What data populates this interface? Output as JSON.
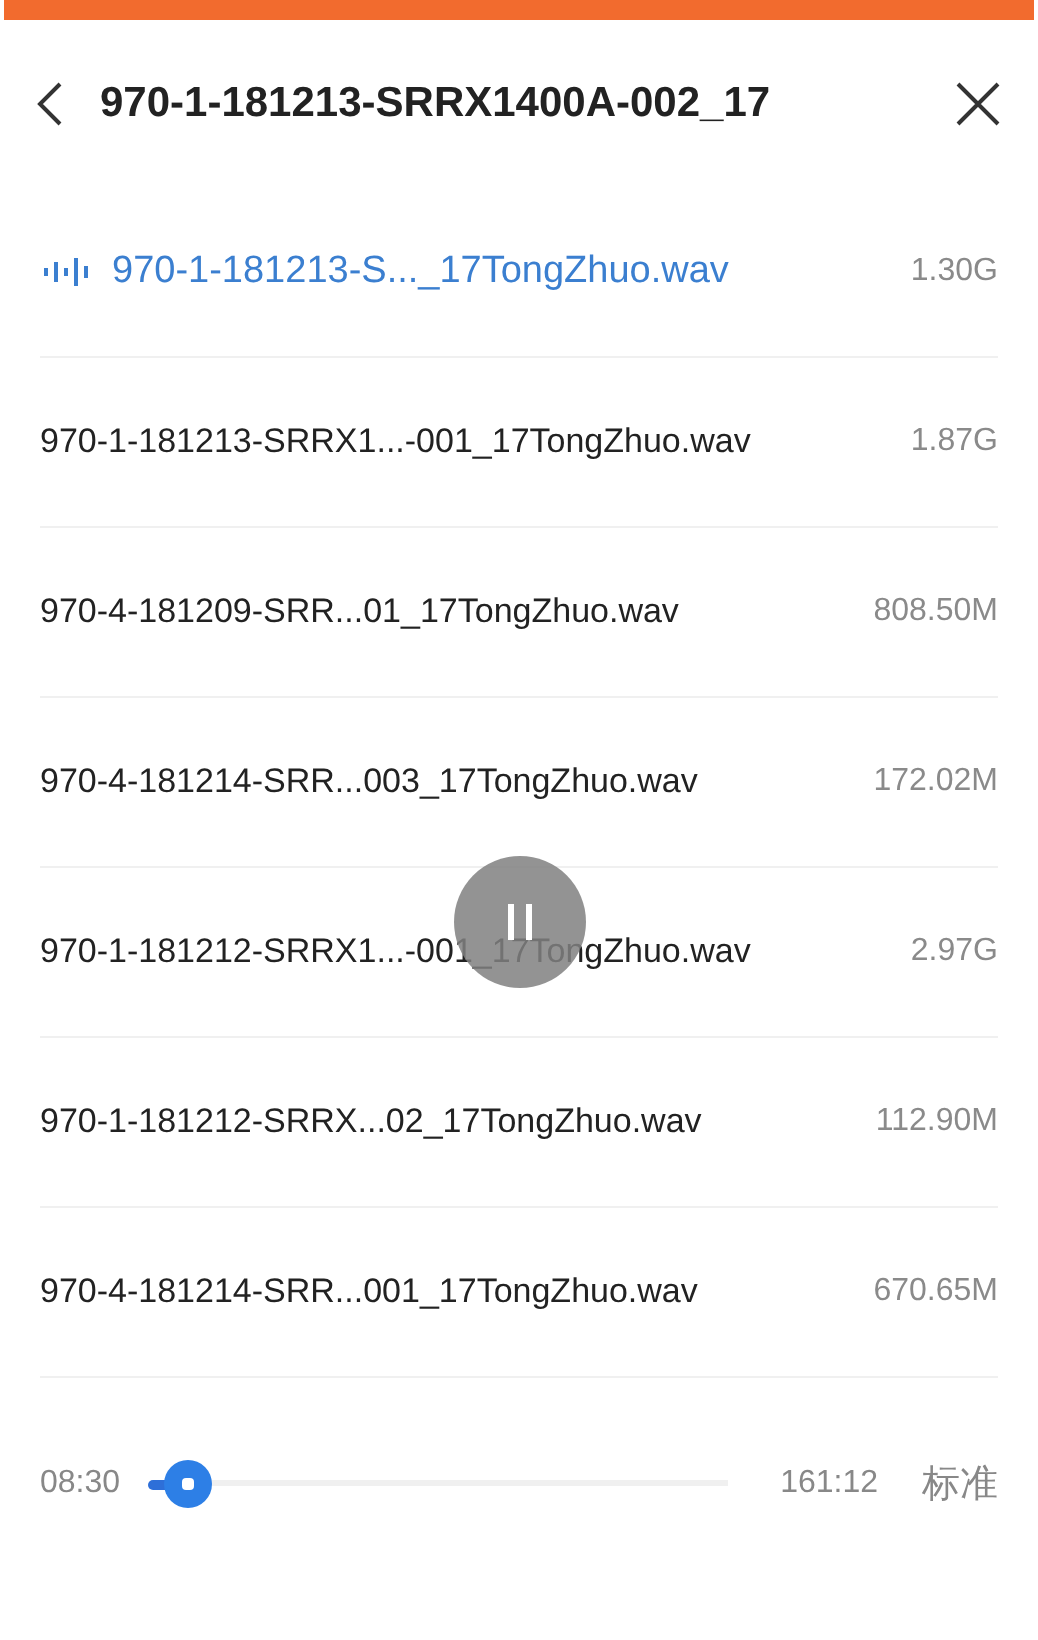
{
  "header": {
    "title": "970-1-181213-SRRX1400A-002_17"
  },
  "files": [
    {
      "name": "970-1-181213-S..._17TongZhuo.wav",
      "size": "1.30G",
      "selected": true
    },
    {
      "name": "970-1-181213-SRRX1...-001_17TongZhuo.wav",
      "size": "1.87G",
      "selected": false
    },
    {
      "name": "970-4-181209-SRR...01_17TongZhuo.wav",
      "size": "808.50M",
      "selected": false
    },
    {
      "name": "970-4-181214-SRR...003_17TongZhuo.wav",
      "size": "172.02M",
      "selected": false
    },
    {
      "name": "970-1-181212-SRRX1...-001_17TongZhuo.wav",
      "size": "2.97G",
      "selected": false
    },
    {
      "name": "970-1-181212-SRRX...02_17TongZhuo.wav",
      "size": "112.90M",
      "selected": false
    },
    {
      "name": "970-4-181214-SRR...001_17TongZhuo.wav",
      "size": "670.65M",
      "selected": false
    }
  ],
  "player": {
    "elapsed": "08:30",
    "level": 0.07,
    "duration": "161:12",
    "speed": "标准",
    "playing": true
  }
}
